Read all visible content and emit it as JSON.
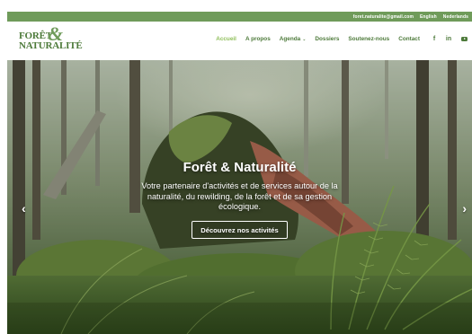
{
  "topbar": {
    "email": "foret.naturalite@gmail.com",
    "lang_en": "English",
    "lang_nl": "Nederlands",
    "bg_color": "#6f9b5a"
  },
  "logo": {
    "line1": "FORÊT",
    "ampersand": "&",
    "line2": "NATURALITÉ"
  },
  "nav": {
    "items": [
      {
        "label": "Accueil",
        "active": true
      },
      {
        "label": "A propos"
      },
      {
        "label": "Agenda"
      },
      {
        "label": "Dossiers"
      },
      {
        "label": "Soutenez-nous"
      },
      {
        "label": "Contact"
      }
    ],
    "agenda_caret": "⌄",
    "social": {
      "facebook": "f",
      "linkedin": "in",
      "youtube": "youtube-icon"
    },
    "text_color": "#4d7a3a",
    "active_color": "#8fbf5a"
  },
  "hero": {
    "title": "Forêt & Naturalité",
    "subtitle": "Votre partenaire d'activités et de services autour de la naturalité, du rewilding, de la forêt et de sa gestion écologique.",
    "button_label": "Découvrez nos activités",
    "prev_arrow": "‹",
    "next_arrow": "›",
    "slide_count": 3,
    "active_slide": 1
  }
}
